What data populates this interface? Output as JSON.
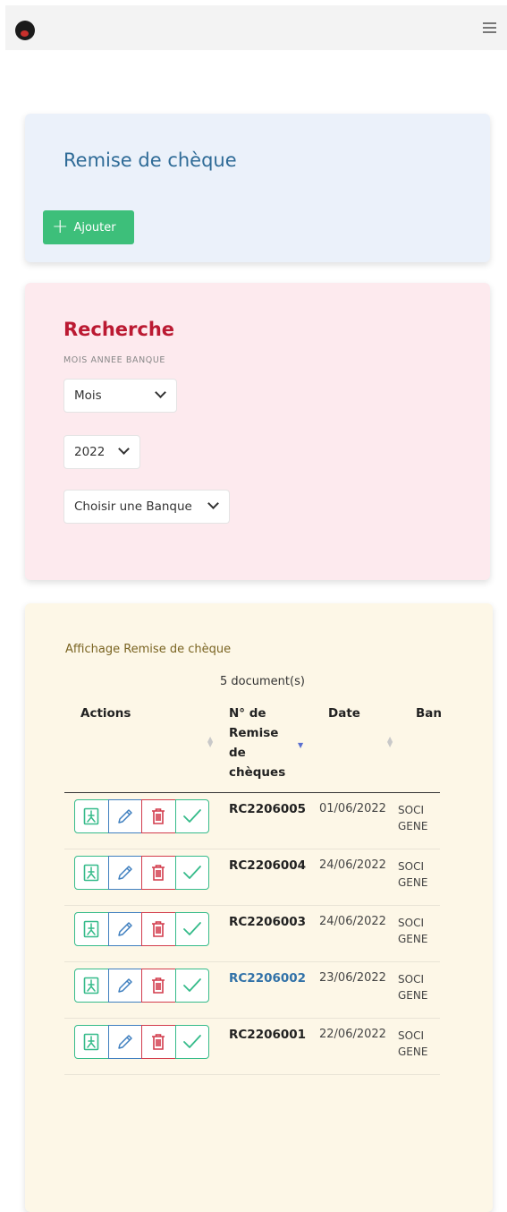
{
  "header": {
    "menu_icon": "hamburger-icon",
    "logo": "app-logo"
  },
  "cheque_section": {
    "title": "Remise de chèque",
    "add_label": "Ajouter"
  },
  "search": {
    "title": "Recherche",
    "filter_label": "MOIS ANNEE BANQUE",
    "month_value": "Mois",
    "year_value": "2022",
    "bank_value": "Choisir une Banque"
  },
  "results": {
    "title": "Affichage Remise de chèque",
    "count": "5 document(s)",
    "columns": {
      "actions": "Actions",
      "numero_lines": [
        "N° de",
        "Remise",
        "de",
        "chèques"
      ],
      "date": "Date",
      "banque": "Ban"
    },
    "rows": [
      {
        "numero": "RC2206005",
        "date": "01/06/2022",
        "bank_line1": "SOCI",
        "bank_line2": "GENE"
      },
      {
        "numero": "RC2206004",
        "date": "24/06/2022",
        "bank_line1": "SOCI",
        "bank_line2": "GENE"
      },
      {
        "numero": "RC2206003",
        "date": "24/06/2022",
        "bank_line1": "SOCI",
        "bank_line2": "GENE"
      },
      {
        "numero": "RC2206002",
        "date": "23/06/2022",
        "bank_line1": "SOCI",
        "bank_line2": "GENE"
      },
      {
        "numero": "RC2206001",
        "date": "22/06/2022",
        "bank_line1": "SOCI",
        "bank_line2": "GENE"
      }
    ]
  },
  "colors": {
    "green": "#3dbf7a",
    "blue_title": "#2f6b97",
    "red_title": "#bb1a32",
    "link": "#3272a8"
  }
}
